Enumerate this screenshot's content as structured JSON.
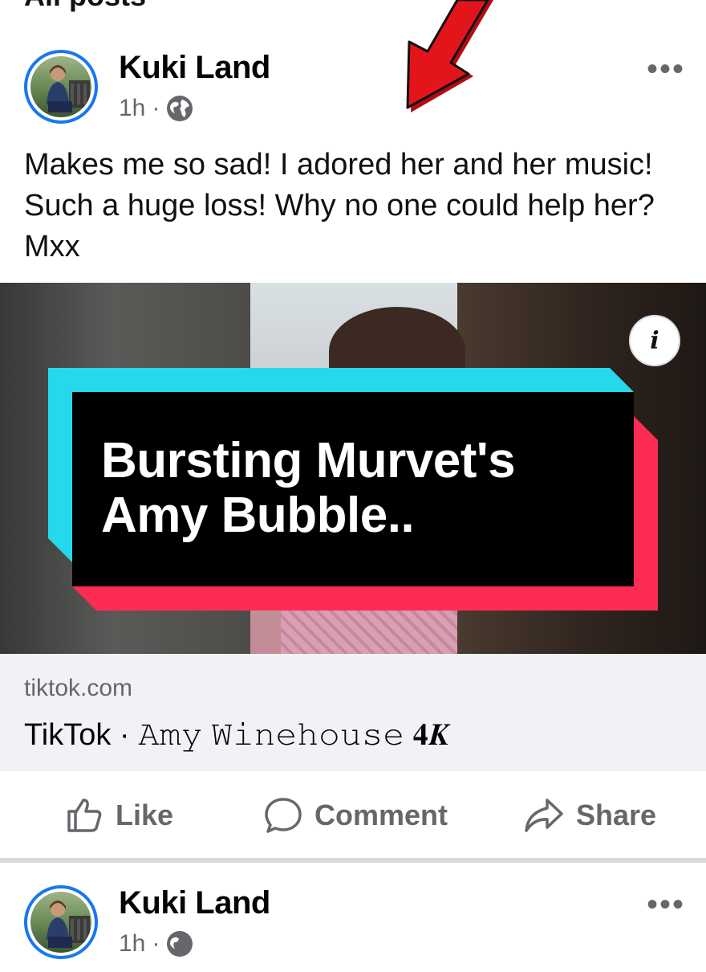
{
  "section_title": "All posts",
  "posts": [
    {
      "author": "Kuki Land",
      "time": "1h",
      "separator": "·",
      "text": "Makes me so sad! I adored her and her music! Such a huge loss! Why no one could help her? Mxx",
      "media_overlay_text": "Bursting Murvet's Amy Bubble..",
      "info_label": "i",
      "link_domain": "tiktok.com",
      "link_title": "TikTok · 𝙰𝚖𝚢 𝚆𝚒𝚗𝚎𝚑𝚘𝚞𝚜𝚎 𝟒𝑲",
      "actions": {
        "like": "Like",
        "comment": "Comment",
        "share": "Share"
      },
      "more": "•••"
    },
    {
      "author": "Kuki Land",
      "time": "1h",
      "separator": "·",
      "more": "•••"
    }
  ],
  "colors": {
    "accent": "#1877f2",
    "overlay_cyan": "#25d8ec",
    "overlay_pink": "#fe2c55",
    "arrow_red": "#e3151a"
  },
  "icons": {
    "privacy": "globe-icon",
    "more": "more-options-icon",
    "info": "info-icon",
    "like": "thumbs-up-icon",
    "comment": "comment-bubble-icon",
    "share": "share-arrow-icon",
    "annotation": "red-arrow-icon"
  }
}
